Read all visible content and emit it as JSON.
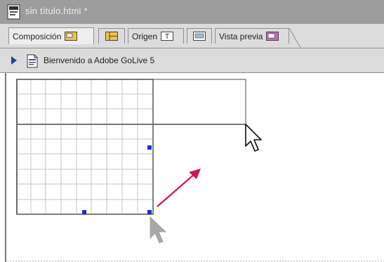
{
  "window": {
    "title": "sin título.html *"
  },
  "tabs": [
    {
      "label": "Composición",
      "icon": "layout-icon",
      "active": true
    },
    {
      "label": "",
      "icon": "frame-icon",
      "active": false
    },
    {
      "label": "Origen",
      "icon": "source-icon",
      "active": false
    },
    {
      "label": "",
      "icon": "outline-icon",
      "active": false
    },
    {
      "label": "Vista previa",
      "icon": "preview-icon",
      "active": false
    }
  ],
  "breadcrumb": {
    "label": "Bienvenido a Adobe GoLive 5"
  },
  "colors": {
    "titlebar": "#9c9c9c",
    "toolbar": "#dcdcdc",
    "arrow": "#d0145a",
    "handle": "#1a2bd6"
  }
}
